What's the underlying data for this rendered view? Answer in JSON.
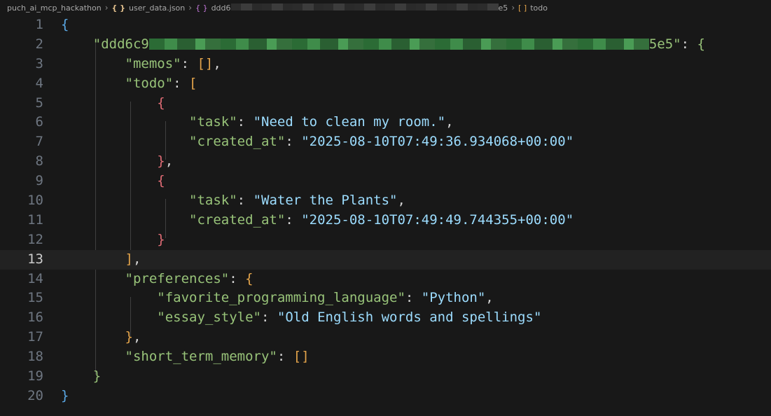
{
  "breadcrumb": {
    "items": [
      {
        "label": "puch_ai_mcp_hackathon",
        "icon": "",
        "icon_name": ""
      },
      {
        "label": "user_data.json",
        "icon": "{ }",
        "icon_name": "json-file-icon"
      },
      {
        "label_start": "ddd6",
        "label_end": "e5",
        "icon": "{ }",
        "icon_name": "object-icon"
      },
      {
        "label": "todo",
        "icon": "[ ]",
        "icon_name": "array-icon"
      }
    ]
  },
  "editor": {
    "current_line": 13,
    "line_numbers": [
      "1",
      "2",
      "3",
      "4",
      "5",
      "6",
      "7",
      "8",
      "9",
      "10",
      "11",
      "12",
      "13",
      "14",
      "15",
      "16",
      "17",
      "18",
      "19",
      "20"
    ],
    "user_key_start": "\"ddd6c9",
    "user_key_end": "5e5\"",
    "keys": {
      "memos": "\"memos\"",
      "todo": "\"todo\"",
      "task": "\"task\"",
      "created_at": "\"created_at\"",
      "preferences": "\"preferences\"",
      "favorite_programming_language": "\"favorite_programming_language\"",
      "essay_style": "\"essay_style\"",
      "short_term_memory": "\"short_term_memory\""
    },
    "values": {
      "task1": "\"Need to clean my room.\"",
      "created1": "\"2025-08-10T07:49:36.934068+00:00\"",
      "task2": "\"Water the Plants\"",
      "created2": "\"2025-08-10T07:49:49.744355+00:00\"",
      "language": "\"Python\"",
      "essay": "\"Old English words and spellings\""
    }
  },
  "colors": {
    "background": "#181818",
    "key": "#98c379",
    "string_value": "#9cdcfe",
    "bracket_level1": "#5aa9e6",
    "bracket_level2": "#98c379",
    "bracket_level3": "#e5a54b",
    "bracket_level4": "#e06c75"
  }
}
